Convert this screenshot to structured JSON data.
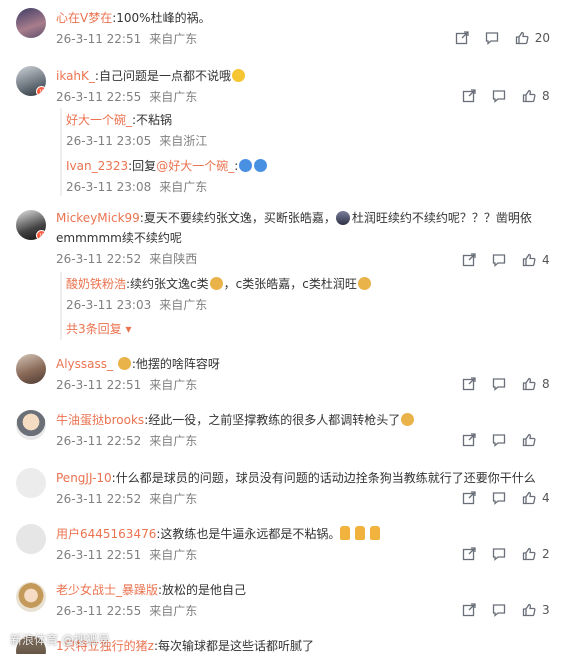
{
  "comments": [
    {
      "user": "心在V梦在",
      "text": ":100%杜峰的祸。",
      "time": "26-3-11 22:51",
      "loc": "来自广东",
      "likes": "20"
    },
    {
      "user": "ikahK_",
      "text": ":自己问题是一点都不说哦",
      "time": "26-3-11 22:55",
      "loc": "来自广东",
      "likes": "8",
      "replies": [
        {
          "user": "好大一个碗_",
          "text": ":不粘锅",
          "time": "26-3-11 23:05",
          "loc": "来自浙江"
        },
        {
          "user": "Ivan_2323",
          "text_prefix": ":回复",
          "mention": "@好大一个碗_",
          "text": ":",
          "time": "26-3-11 23:08",
          "loc": "来自广东"
        }
      ]
    },
    {
      "user": "MickeyMick99",
      "text": ":夏天不要续约张文逸，买断张皓嘉，",
      "text2": "杜润旺续约不续约呢？？？凿明依",
      "line2": "emmmmm续不续约呢",
      "time": "26-3-11 22:52",
      "loc": "来自陕西",
      "likes": "4",
      "replies": [
        {
          "user": "酸奶铁粉浩",
          "text": ":续约张文逸c类",
          "text2": "，c类张皓嘉，c类杜润旺",
          "time": "26-3-11 23:03",
          "loc": "来自广东"
        }
      ],
      "more": "共3条回复"
    },
    {
      "user": "Alyssass_",
      "text": ":他摆的啥阵容呀",
      "time": "26-3-11 22:51",
      "loc": "来自广东",
      "likes": "8"
    },
    {
      "user": "牛油蛋挞brooks",
      "text": ":经此一役，之前坚撑教练的很多人都调转枪头了",
      "time": "26-3-11 22:52",
      "loc": "来自广东",
      "likes": ""
    },
    {
      "user": "PengJJ-10",
      "text": ":什么都是球员的问题，球员没有问题的话动边拴条狗当教练就行了还要你干什么",
      "time": "26-3-11 22:52",
      "loc": "来自广东",
      "likes": "4"
    },
    {
      "user": "用户6445163476",
      "text": ":这教练也是牛逼永远都是不粘锅。",
      "time": "26-3-11 22:51",
      "loc": "来自广东",
      "likes": "2"
    },
    {
      "user": "老少女战士_暴躁版",
      "text": ":放松的是他自己",
      "time": "26-3-11 22:55",
      "loc": "来自广东",
      "likes": "3"
    },
    {
      "user": "1只特立独行的猪z",
      "text": ":每次输球都是这些话都听腻了",
      "time": "",
      "loc": "",
      "likes": ""
    }
  ],
  "watermark": "新浪体育 @搜狐号",
  "colors": {
    "username": "#eb7350",
    "meta": "#808080",
    "text": "#333333",
    "thread_line": "#eeeeee"
  },
  "icons": {
    "share": "share-icon",
    "comment": "comment-icon",
    "like": "thumb-up-icon"
  }
}
